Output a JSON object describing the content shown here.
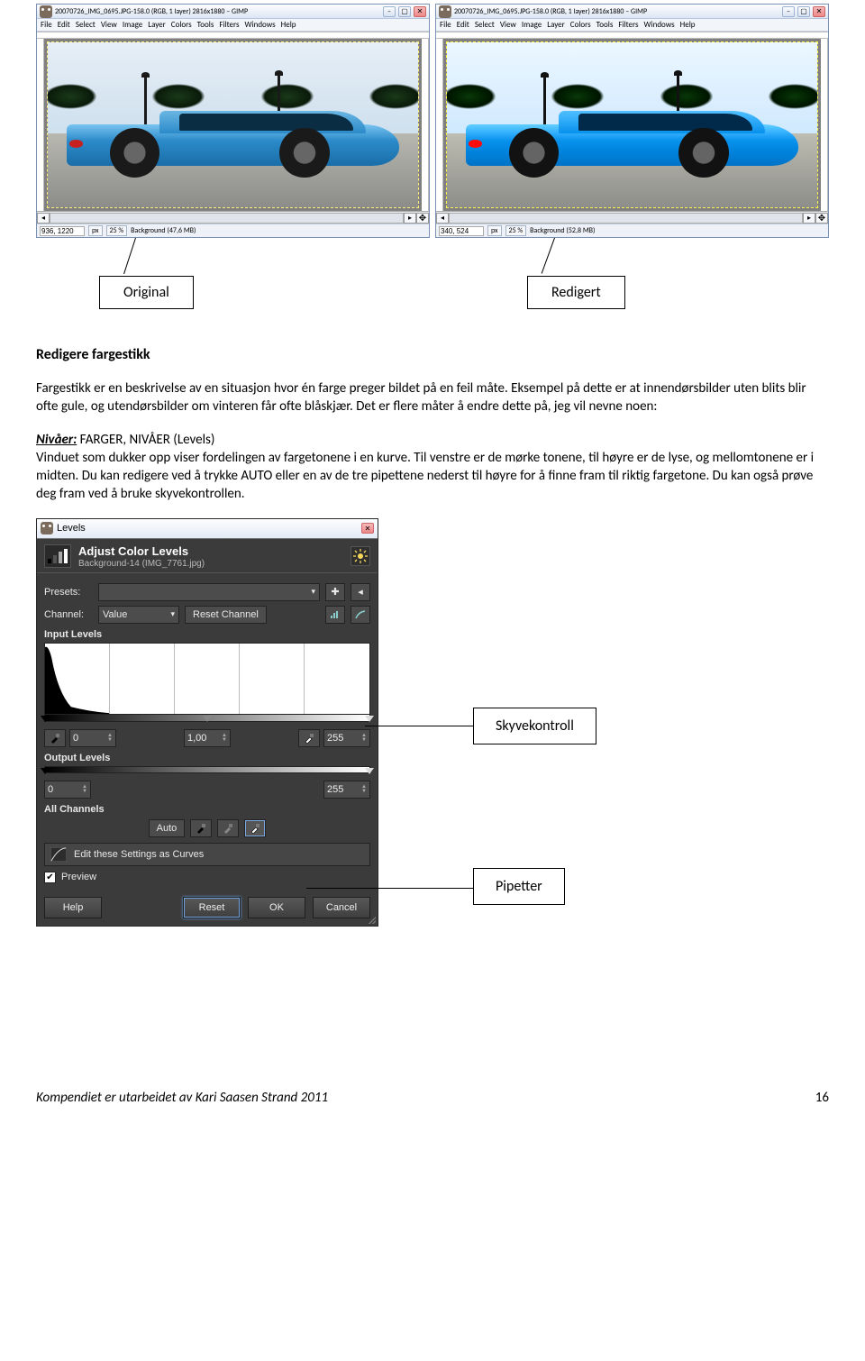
{
  "gimp": {
    "title_left": "20070726_IMG_0695.JPG-158.0 (RGB, 1 layer) 2816x1880 – GIMP",
    "title_right": "20070726_IMG_0695.JPG-158.0 (RGB, 1 layer) 2816x1880 – GIMP",
    "menu": [
      "File",
      "Edit",
      "Select",
      "View",
      "Image",
      "Layer",
      "Colors",
      "Tools",
      "Filters",
      "Windows",
      "Help"
    ],
    "status_left": {
      "coords": "936, 1220",
      "unit": "px",
      "zoom": "25 %",
      "bg": "Background (47,6 MB)"
    },
    "status_right": {
      "coords": "340, 524",
      "unit": "px",
      "zoom": "25 %",
      "bg": "Background (52,8 MB)"
    }
  },
  "labels": {
    "original": "Original",
    "redigert": "Redigert"
  },
  "heading": "Redigere fargestikk",
  "para1": "Fargestikk er en beskrivelse av en situasjon hvor én farge preger bildet på en feil måte. Eksempel på dette er at innendørsbilder uten blits blir ofte gule, og utendørsbilder om vinteren får ofte blåskjær. Det er flere måter å endre dette på, jeg vil nevne noen:",
  "nivaaer_label": "Nivåer:",
  "nivaaer_path": " FARGER, NIVÅER (Levels)",
  "para2": "Vinduet som dukker opp viser fordelingen av fargetonene i en kurve. Til venstre er de mørke tonene, til høyre er de lyse, og mellomtonene er i midten. Du kan redigere ved å trykke AUTO eller en av de tre pipettene nederst til høyre for å finne fram til riktig fargetone. Du kan også prøve deg fram ved å bruke skyvekontrollen.",
  "levels": {
    "window_title": "Levels",
    "header_title": "Adjust Color Levels",
    "header_sub": "Background-14 (IMG_7761.jpg)",
    "presets_label": "Presets:",
    "channel_label": "Channel:",
    "channel_value": "Value",
    "reset_channel": "Reset Channel",
    "input_levels": "Input Levels",
    "in_low": "0",
    "in_gamma": "1,00",
    "in_high": "255",
    "output_levels": "Output Levels",
    "out_low": "0",
    "out_high": "255",
    "all_channels": "All Channels",
    "auto": "Auto",
    "curves_text": "Edit these Settings as Curves",
    "preview": "Preview",
    "help": "Help",
    "reset": "Reset",
    "ok": "OK",
    "cancel": "Cancel"
  },
  "annotations": {
    "skyvekontroll": "Skyvekontroll",
    "pipetter": "Pipetter"
  },
  "footer": {
    "credit": "Kompendiet er utarbeidet av Kari Saasen Strand 2011",
    "page": "16"
  }
}
